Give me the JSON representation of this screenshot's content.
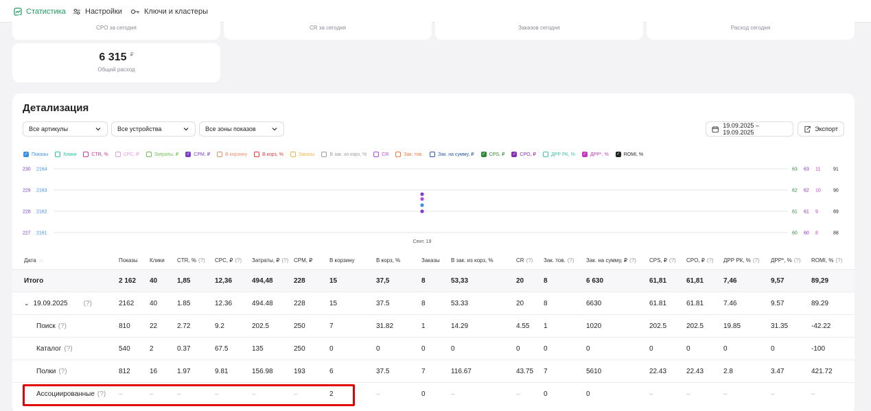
{
  "nav": {
    "tabs": [
      {
        "label": "Статистика"
      },
      {
        "label": "Настройки"
      },
      {
        "label": "Ключи и кластеры"
      }
    ]
  },
  "cards_top": [
    "CPO за сегодня",
    "CR за сегодня",
    "Заказов сегодня",
    "Расход сегодня"
  ],
  "card_spend": {
    "value": "6 315",
    "currency": "₽",
    "label": "Общий расход"
  },
  "panel": {
    "title": "Детализация",
    "filters": [
      "Все артикулы",
      "Все устройства",
      "Все зоны показов"
    ],
    "date_range": "19.09.2025 – 19.09.2025",
    "export": "Экспорт"
  },
  "legend": [
    {
      "label": "Показы",
      "color": "#3d8fe0",
      "checked": true
    },
    {
      "label": "Клики",
      "color": "#1fc7a8",
      "checked": false
    },
    {
      "label": "CTR, %",
      "color": "#c43a9e",
      "checked": false
    },
    {
      "label": "CPC, ₽",
      "color": "#e99be0",
      "checked": false
    },
    {
      "label": "Затраты, ₽",
      "color": "#6cbd4f",
      "checked": false
    },
    {
      "label": "CPM, ₽",
      "color": "#7c3fc6",
      "checked": true
    },
    {
      "label": "В корзину",
      "color": "#f08b6a",
      "checked": false
    },
    {
      "label": "В корз, %",
      "color": "#e53a3a",
      "checked": false
    },
    {
      "label": "Заказы",
      "color": "#f3b44c",
      "checked": false
    },
    {
      "label": "В зак. из корз, %",
      "color": "#9b9ba5",
      "checked": false
    },
    {
      "label": "CR",
      "color": "#b04cd8",
      "checked": false
    },
    {
      "label": "Зак. тов.",
      "color": "#f07a3a",
      "checked": false
    },
    {
      "label": "Зак. на сумму, ₽",
      "color": "#2a5aa8",
      "checked": false
    },
    {
      "label": "CPS, ₽",
      "color": "#2f8a3a",
      "checked": true
    },
    {
      "label": "CPO, ₽",
      "color": "#8c2ab8",
      "checked": true
    },
    {
      "label": "ДРР РК, %",
      "color": "#3ec5a5",
      "checked": false
    },
    {
      "label": "ДРР*, %",
      "color": "#c23ab8",
      "checked": true
    },
    {
      "label": "ROMI, %",
      "color": "#222222",
      "checked": true
    }
  ],
  "chart_data": {
    "type": "scatter",
    "x_tick": "Сент. 19",
    "left_axis_a": [
      "230",
      "229",
      "228",
      "227"
    ],
    "left_axis_b": [
      "2164",
      "2163",
      "2162",
      "2161"
    ],
    "right_axis_a": [
      "63",
      "62",
      "61",
      "60"
    ],
    "right_axis_b": [
      "63",
      "62",
      "61",
      "60"
    ],
    "right_axis_c": [
      "11",
      "10",
      "9",
      "8"
    ],
    "right_axis_d": [
      "91",
      "90",
      "89",
      "88"
    ],
    "points": [
      {
        "series": "CPM, ₽",
        "value": 228
      },
      {
        "series": "Показы",
        "value": 2162
      }
    ],
    "axis_colors": {
      "a": "#7c3fc6",
      "b": "#3d8fe0",
      "ra": "#2f8a3a",
      "rb": "#8c2ab8",
      "rc": "#c23ab8",
      "rd": "#222222"
    },
    "grid": true
  },
  "table": {
    "headers": [
      "Дата",
      "Показы",
      "Клики",
      "CTR, %",
      "CPC, ₽",
      "Затраты, ₽",
      "CPM, ₽",
      "В корзину",
      "В корз, %",
      "Заказы",
      "В зак. из корз, %",
      "CR",
      "Зак. тов.",
      "Зак. на сумму, ₽",
      "CPS, ₽",
      "CPO, ₽",
      "ДРР РК, %",
      "ДРР*, %",
      "ROMI, %"
    ],
    "sort_marker": "↓↑",
    "rows": [
      {
        "type": "total",
        "name": "Итого",
        "cells": [
          "2 162",
          "40",
          "1,85",
          "12,36",
          "494,48",
          "228",
          "15",
          "37,5",
          "8",
          "53,33",
          "20",
          "8",
          "6 630",
          "61,81",
          "61,81",
          "7,46",
          "9,57",
          "89,29"
        ]
      },
      {
        "type": "date",
        "name": "19.09.2025",
        "cells": [
          "2162",
          "40",
          "1.85",
          "12.36",
          "494.48",
          "228",
          "15",
          "37.5",
          "8",
          "53.33",
          "20",
          "8",
          "6630",
          "61.81",
          "61.81",
          "7.46",
          "9.57",
          "89.29"
        ]
      },
      {
        "type": "sub",
        "name": "Поиск",
        "cells": [
          "810",
          "22",
          "2.72",
          "9.2",
          "202.5",
          "250",
          "7",
          "31.82",
          "1",
          "14.29",
          "4.55",
          "1",
          "1020",
          "202.5",
          "202.5",
          "19.85",
          "31.35",
          "-42.22"
        ]
      },
      {
        "type": "sub",
        "name": "Каталог",
        "cells": [
          "540",
          "2",
          "0.37",
          "67.5",
          "135",
          "250",
          "0",
          "0",
          "0",
          "0",
          "0",
          "0",
          "0",
          "0",
          "0",
          "0",
          "0",
          "-100"
        ]
      },
      {
        "type": "sub",
        "name": "Полки",
        "cells": [
          "812",
          "16",
          "1.97",
          "9.81",
          "156.98",
          "193",
          "6",
          "37.5",
          "7",
          "116.67",
          "43.75",
          "7",
          "5610",
          "22.43",
          "22.43",
          "2.8",
          "3.47",
          "421.72"
        ]
      },
      {
        "type": "sub",
        "name": "Ассоциированные",
        "cells": [
          "–",
          "–",
          "–",
          "–",
          "–",
          "–",
          "2",
          "–",
          "0",
          "–",
          "–",
          "0",
          "0",
          "–",
          "–",
          "–",
          "–",
          "–"
        ]
      }
    ]
  },
  "help": "(?)"
}
